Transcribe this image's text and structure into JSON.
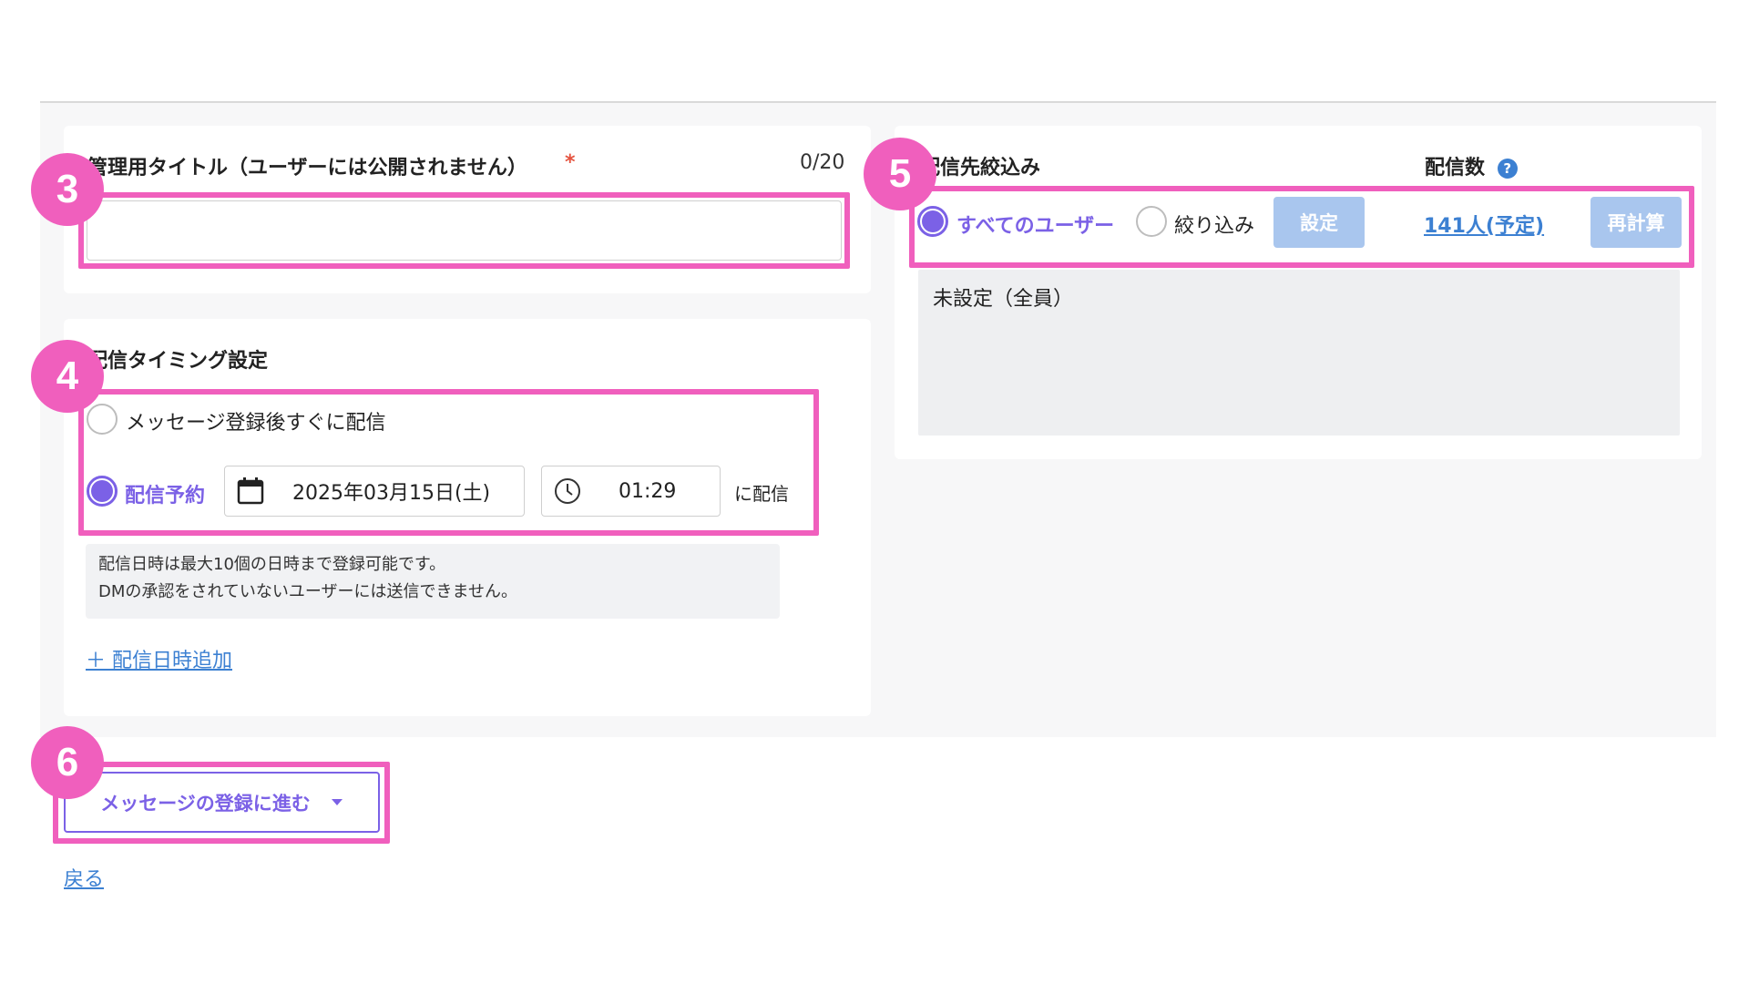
{
  "title_section": {
    "label": "管理用タイトル（ユーザーには公開されません）",
    "required_mark": "*",
    "counter": "0/20",
    "input_value": "",
    "badge": "3"
  },
  "timing_section": {
    "label": "配信タイミング設定",
    "badge": "4",
    "options": [
      {
        "label": "メッセージ登録後すぐに配信",
        "selected": false
      },
      {
        "label": "配信予約",
        "selected": true
      }
    ],
    "date_value": "2025年03月15日(土)",
    "time_value": "01:29",
    "suffix": "に配信",
    "note_line1": "配信日時は最大10個の日時まで登録可能です。",
    "note_line2": "DMの承認をされていないユーザーには送信できません。",
    "add_link": "＋ 配信日時追加"
  },
  "target_section": {
    "label": "配信先絞込み",
    "count_label": "配信数",
    "help_icon": "?",
    "badge": "5",
    "options": [
      {
        "label": "すべてのユーザー",
        "selected": true
      },
      {
        "label": "絞り込み",
        "selected": false
      }
    ],
    "settings_button": "設定",
    "count_link": "141人(予定)",
    "recalc_button": "再計算",
    "filter_summary": "未設定（全員）"
  },
  "actions": {
    "badge": "6",
    "proceed_button": "メッセージの登録に進む",
    "back_link": "戻る"
  },
  "colors": {
    "accent": "#7b61e6",
    "highlight": "#f05fbd",
    "link": "#3c80d2",
    "disabled_button": "#a9c6ee",
    "required": "#e5533f"
  }
}
